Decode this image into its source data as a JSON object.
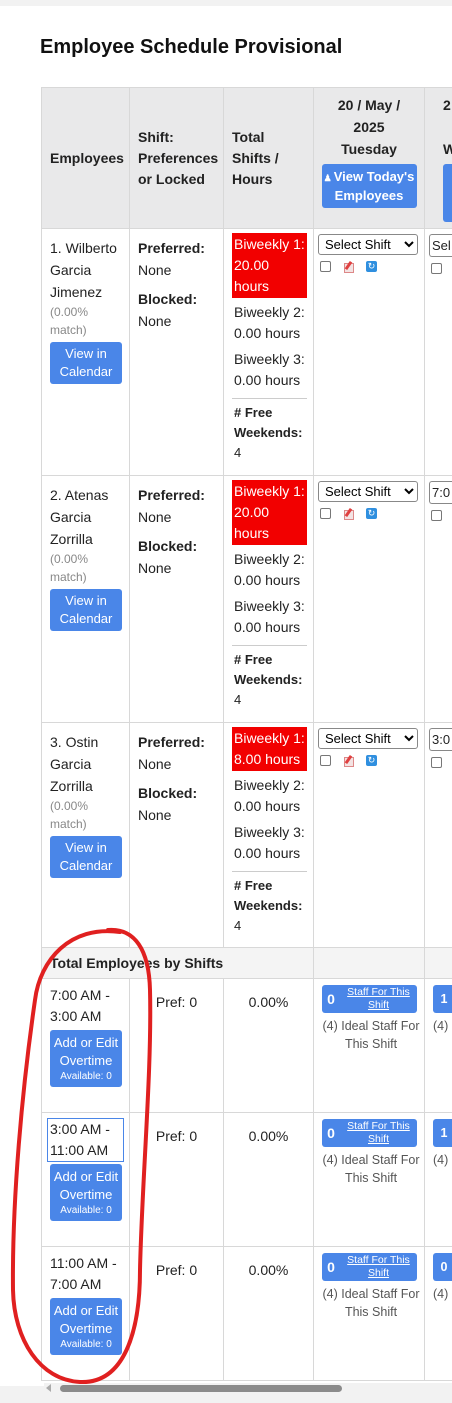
{
  "title": "Employee Schedule Provisional",
  "columns": {
    "employees": "Employees",
    "shift": "Shift: Preferences or Locked",
    "total": "Total Shifts / Hours",
    "date_line1": "20 / May /",
    "date_line2": "2025",
    "date_line3": "Tuesday",
    "next_date_partial": "2",
    "next_day_partial": "W",
    "view_today": "View Today's Employees"
  },
  "employees": [
    {
      "name": "1. Wilberto Garcia Jimenez",
      "match": "(0.00% match)",
      "calendar_btn": "View in Calendar",
      "preferred_label": "Preferred:",
      "preferred": "None",
      "blocked_label": "Blocked:",
      "blocked": "None",
      "biweekly1": "Biweekly 1: 20.00 hours",
      "biweekly2": "Biweekly 2: 0.00 hours",
      "biweekly3": "Biweekly 3: 0.00 hours",
      "free_weekends_label": "# Free Weekends:",
      "free_weekends": "4",
      "select_value": "Select Shift",
      "next_select": "Sel"
    },
    {
      "name": "2. Atenas Garcia Zorrilla",
      "match": "(0.00% match)",
      "calendar_btn": "View in Calendar",
      "preferred_label": "Preferred:",
      "preferred": "None",
      "blocked_label": "Blocked:",
      "blocked": "None",
      "biweekly1": "Biweekly 1: 20.00 hours",
      "biweekly2": "Biweekly 2: 0.00 hours",
      "biweekly3": "Biweekly 3: 0.00 hours",
      "free_weekends_label": "# Free Weekends:",
      "free_weekends": "4",
      "select_value": "Select Shift",
      "next_select": "7:0"
    },
    {
      "name": "3. Ostin Garcia Zorrilla",
      "match": "(0.00% match)",
      "calendar_btn": "View in Calendar",
      "preferred_label": "Preferred:",
      "preferred": "None",
      "blocked_label": "Blocked:",
      "blocked": "None",
      "biweekly1": "Biweekly 1: 8.00 hours",
      "biweekly2": "Biweekly 2: 0.00 hours",
      "biweekly3": "Biweekly 3: 0.00 hours",
      "free_weekends_label": "# Free Weekends:",
      "free_weekends": "4",
      "select_value": "Select Shift",
      "next_select": "3:0"
    }
  ],
  "summary_header": "Total Employees by Shifts",
  "shifts": [
    {
      "range": "7:00 AM - 3:00 AM",
      "overtime_btn": "Add or Edit Overtime",
      "available": "Available: 0",
      "pref": "Pref: 0",
      "pct": "0.00%",
      "staff_count": "0",
      "staff_label": "Staff For This Shift",
      "ideal": "(4) Ideal Staff For This Shift",
      "next_count": "1",
      "next_ideal": "(4)"
    },
    {
      "range": "3:00 AM - 11:00 AM",
      "overtime_btn": "Add or Edit Overtime",
      "available": "Available: 0",
      "pref": "Pref: 0",
      "pct": "0.00%",
      "staff_count": "0",
      "staff_label": "Staff For This Shift",
      "ideal": "(4) Ideal Staff For This Shift",
      "next_count": "1",
      "next_ideal": "(4)"
    },
    {
      "range": "11:00 AM - 7:00 AM",
      "overtime_btn": "Add or Edit Overtime",
      "available": "Available: 0",
      "pref": "Pref: 0",
      "pct": "0.00%",
      "staff_count": "0",
      "staff_label": "Staff For This Shift",
      "ideal": "(4) Ideal Staff For This Shift",
      "next_count": "0",
      "next_ideal": "(4)"
    }
  ],
  "colors": {
    "accent": "#4a86e8",
    "alert": "#f20000",
    "annotation": "#e02020"
  }
}
